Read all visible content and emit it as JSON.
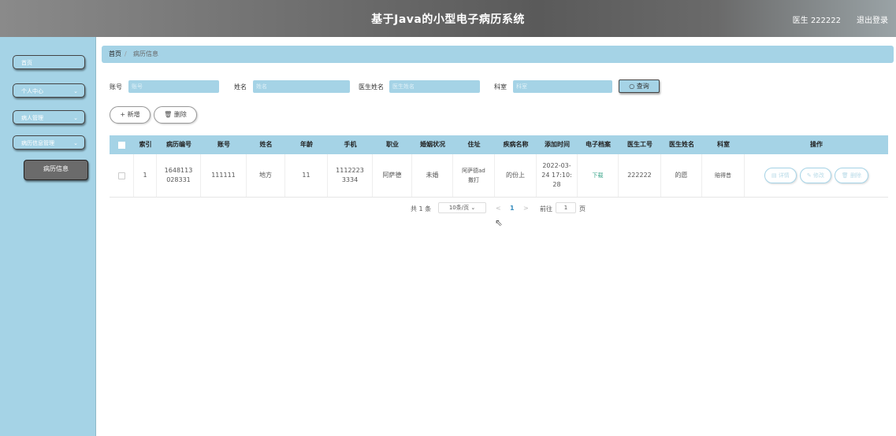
{
  "header": {
    "title": "基于Java的小型电子病历系统",
    "user": "医生 222222",
    "logout": "退出登录"
  },
  "sidebar": {
    "items": [
      {
        "label": "首页",
        "chevron": ""
      },
      {
        "label": "个人中心",
        "chevron": "⌄"
      },
      {
        "label": "病人管理",
        "chevron": "⌄"
      },
      {
        "label": "病历信息管理",
        "chevron": "⌄"
      }
    ],
    "sub_item": "病历信息"
  },
  "breadcrumb": {
    "home": "首页",
    "sep": "/",
    "current": "病历信息"
  },
  "search": {
    "labels": {
      "account": "账号",
      "name": "姓名",
      "doctor_name": "医生姓名",
      "dept": "科室"
    },
    "placeholders": {
      "account": "账号",
      "name": "姓名",
      "doctor_name": "医生姓名",
      "dept": "科室"
    },
    "button": "查询",
    "search_icon": "search-icon"
  },
  "actions": {
    "add": "新增",
    "delete": "删除",
    "add_icon": "+",
    "delete_icon": "🗑"
  },
  "table": {
    "headers": [
      "索引",
      "病历编号",
      "账号",
      "姓名",
      "年龄",
      "手机",
      "职业",
      "婚姻状况",
      "住址",
      "疾病名称",
      "添加时间",
      "电子档案",
      "医生工号",
      "医生姓名",
      "科室",
      "操作"
    ],
    "rows": [
      {
        "index": "1",
        "record_no": "1648113028331",
        "account": "111111",
        "name": "地方",
        "age": "11",
        "phone": "11122233334",
        "job": "阿萨德",
        "marital": "未婚",
        "address": "阿萨德ad撒打",
        "disease": "的份上",
        "time": "2022-03-24 17:10:28",
        "file": "下载",
        "doctor_id": "222222",
        "doctor_name": "的愿",
        "dept": "賠得昔",
        "ops": {
          "detail": "详情",
          "edit": "修改",
          "delete": "删除"
        }
      }
    ]
  },
  "pagination": {
    "total": "共 1 条",
    "page_size": "10条/页",
    "prev": "<",
    "current": "1",
    "next": ">",
    "goto": "前往",
    "goto_value": "1",
    "page_unit": "页"
  },
  "colors": {
    "accent": "#a5d3e6",
    "header": "#6e6e6e",
    "link": "#3aa58a"
  }
}
